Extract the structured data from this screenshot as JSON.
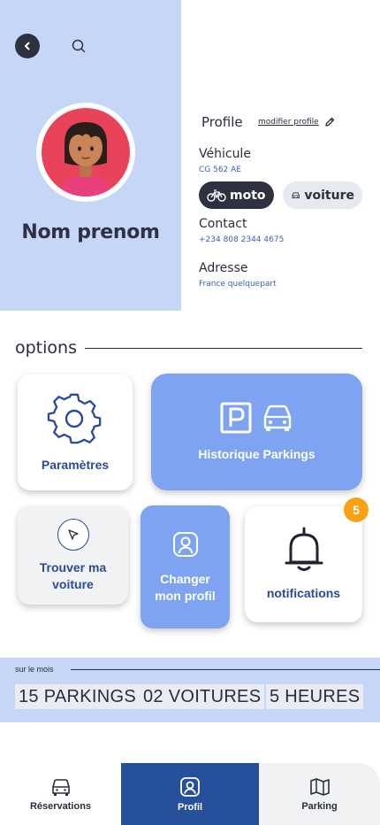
{
  "header": {
    "full_name": "Nom prenom"
  },
  "profile": {
    "title": "Profile",
    "edit_link": "modifier profile",
    "vehicle_label": "Véhicule",
    "vehicle_plate": "CG 562 AE",
    "chips": {
      "moto": "moto",
      "voiture": "voiture"
    },
    "contact_label": "Contact",
    "contact_value": "+234 808 2344 4675",
    "address_label": "Adresse",
    "address_value": "France quelquepart"
  },
  "options": {
    "title": "options",
    "settings": "Paramètres",
    "history": "Historique Parkings",
    "find_car_line1": "Trouver ma",
    "find_car_line2": "voiture",
    "change_profile_line1": "Changer",
    "change_profile_line2": "mon profil",
    "notifications": "notifications",
    "notifications_count": "5"
  },
  "stats": {
    "caption": "sur le mois",
    "items": [
      "15 PARKINGS",
      "02 VOITURES",
      "5 HEURES"
    ]
  },
  "nav": {
    "reservations": "Réservations",
    "profil": "Profil",
    "parking": "Parking"
  },
  "colors": {
    "panel_blue": "#c6d6f7",
    "accent_blue": "#7ea3f0",
    "nav_active": "#27509a",
    "dark": "#2e3140",
    "badge_orange": "#f7a113"
  }
}
